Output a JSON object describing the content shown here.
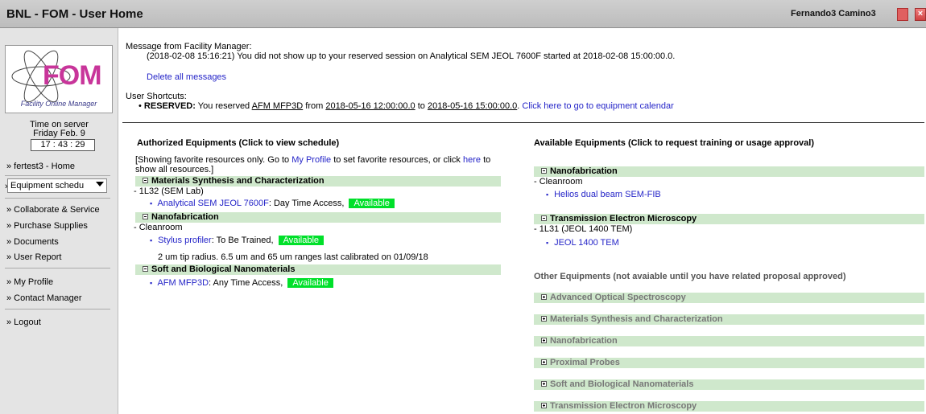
{
  "window": {
    "title": "BNL - FOM - User Home",
    "user_name": "Fernando3 Camino3"
  },
  "sidebar": {
    "logo_text": "FOM",
    "logo_tagline": "Facility Online Manager",
    "time_label": "Time on server",
    "date_label": "Friday Feb. 9",
    "clock": "17 : 43 : 29",
    "home_link": "» fertest3 - Home",
    "select_prefix": "»",
    "select_value": "Equipment schedu",
    "group1": [
      "» Collaborate & Service",
      "» Purchase Supplies",
      "» Documents",
      "» User Report"
    ],
    "group2": [
      "» My Profile",
      "» Contact Manager"
    ],
    "logout": "» Logout"
  },
  "messages": {
    "header": "Message from Facility Manager:",
    "body": "(2018-02-08 15:16:21) You did not show up to your reserved session on Analytical SEM JEOL 7600F started at 2018-02-08 15:00:00.0.",
    "delete_link": "Delete all messages"
  },
  "shortcuts": {
    "header": "User Shortcuts:",
    "bullet": "•",
    "reserved_label": "RESERVED:",
    "text1": " You reserved ",
    "equipment": "AFM MFP3D",
    "text2": " from ",
    "start": "2018-05-16 12:00:00.0",
    "text3": " to ",
    "end": "2018-05-16 15:00:00.0",
    "text4": ". ",
    "calendar_link": "Click here to go to equipment calendar"
  },
  "authorized": {
    "header": "Authorized Equipments (Click to view schedule)",
    "note_a": "[Showing favorite resources only. Go to ",
    "note_profile": "My Profile",
    "note_b": " to set favorite resources, or click ",
    "note_here": "here",
    "note_c": " to",
    "note_line2": "show all resources.]",
    "cat1": "Materials Synthesis and Characterization",
    "cat1_loc": "- 1L32 (SEM Lab)",
    "cat1_item": "Analytical SEM JEOL 7600F",
    "cat1_access": ": Day Time Access, ",
    "cat2": "Nanofabrication",
    "cat2_loc": "- Cleanroom",
    "cat2_item": "Stylus profiler",
    "cat2_access": ": To Be Trained, ",
    "cat2_note": "2 um tip radius. 6.5 um and 65 um ranges last calibrated on 01/09/18",
    "cat3": "Soft and Biological Nanomaterials",
    "cat3_item": "AFM MFP3D",
    "cat3_access": ": Any Time Access, ",
    "status": "Available"
  },
  "available": {
    "header": "Available Equipments (Click to request training or usage approval)",
    "cat1": "Nanofabrication",
    "cat1_loc": "- Cleanroom",
    "cat1_item": "Helios dual beam SEM-FIB",
    "cat2": "Transmission Electron Microscopy",
    "cat2_loc": "- 1L31 (JEOL 1400 TEM)",
    "cat2_item": "JEOL 1400 TEM"
  },
  "other": {
    "header": "Other Equipments (not avaiable until you have related proposal approved)",
    "categories": [
      "Advanced Optical Spectroscopy",
      "Materials Synthesis and Characterization",
      "Nanofabrication",
      "Proximal Probes",
      "Soft and Biological Nanomaterials",
      "Transmission Electron Microscopy"
    ]
  },
  "colors": {
    "category_bar": "#cfe8cc",
    "available_badge": "#00e02a",
    "link": "#2525c8"
  }
}
